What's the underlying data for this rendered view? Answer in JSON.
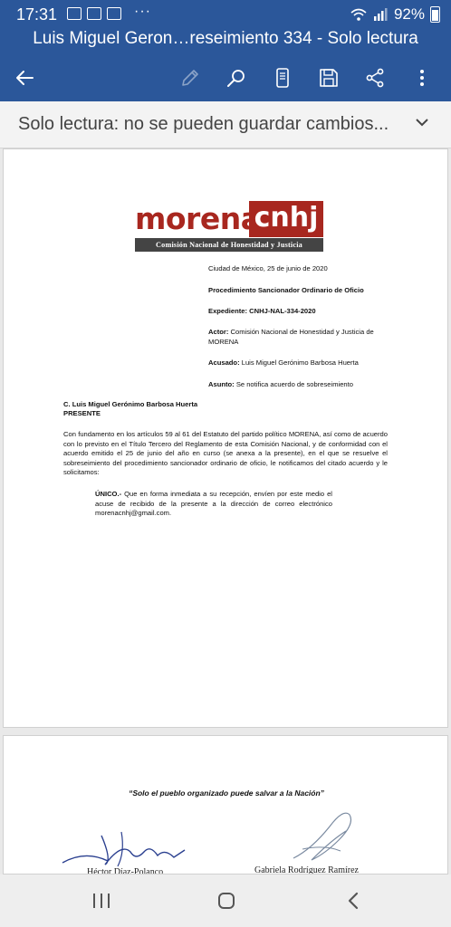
{
  "status_bar": {
    "time": "17:31",
    "dots": "···",
    "battery": "92%"
  },
  "header": {
    "title": "Luis Miguel Geron…reseimiento 334 - Solo lectura"
  },
  "toolbar": {
    "icons": [
      "back-arrow-icon",
      "pen-icon",
      "search-icon",
      "mobile-view-icon",
      "save-icon",
      "share-icon",
      "more-vert-icon"
    ]
  },
  "banner": {
    "text": "Solo lectura: no se pueden guardar cambios..."
  },
  "document": {
    "logo": {
      "morena": "morena",
      "cnhj": "cnhj",
      "subtitle": "Comisión Nacional de Honestidad y Justicia"
    },
    "date": "Ciudad de México, 25 de junio de 2020",
    "procedure": "Procedimiento Sancionador Ordinario de Oficio",
    "expediente_label": "Expediente:",
    "expediente_value": "CNHJ-NAL-334-2020",
    "actor_label": "Actor:",
    "actor_value": "Comisión Nacional de Honestidad y Justicia de MORENA",
    "acusado_label": "Acusado:",
    "acusado_value": "Luis Miguel Gerónimo Barbosa Huerta",
    "asunto_label": "Asunto:",
    "asunto_value": "Se notifica acuerdo de sobreseimiento",
    "recipient": "C. Luis Miguel Gerónimo Barbosa Huerta",
    "presente": "PRESENTE",
    "body": "Con fundamento en los artículos 59 al 61 del Estatuto del partido político MORENA, así como de acuerdo con lo previsto en el Título Tercero del Reglamento de esta Comisión Nacional, y de conformidad con el acuerdo emitido el 25 de junio del año en curso (se anexa a la presente), en el que se resuelve el sobreseimiento del procedimiento sancionador ordinario de oficio, le notificamos del citado acuerdo y le solicitamos:",
    "unico_label": "ÚNICO.-",
    "unico_text": "Que en forma inmediata a su recepción, envíen por este medio el acuse de recibido de la presente a la dirección de correo electrónico morenacnhj@gmail.com.",
    "motto": "“Solo el pueblo organizado puede salvar a la Nación”",
    "signer1": "Héctor Díaz-Polanco",
    "signer2": "Gabriela Rodríguez Ramírez"
  },
  "nav_bar": {
    "icons": [
      "recents-icon",
      "home-icon",
      "back-icon"
    ]
  }
}
